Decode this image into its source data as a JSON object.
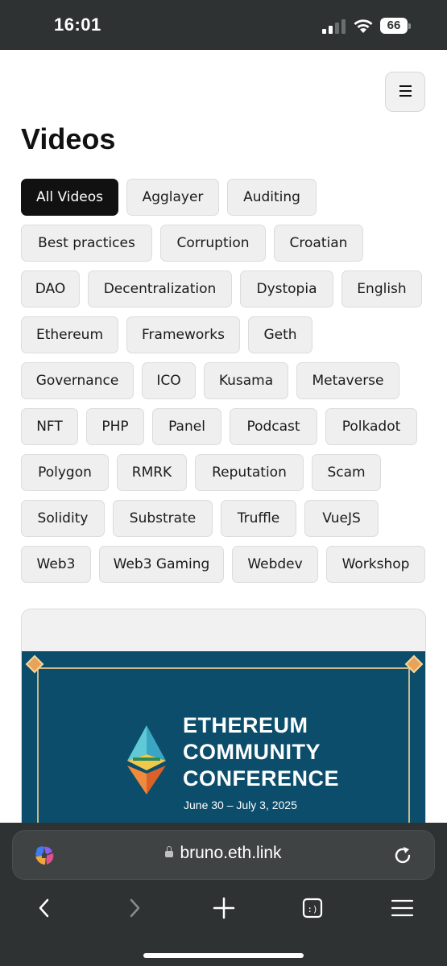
{
  "status_bar": {
    "time": "16:01",
    "battery": "66"
  },
  "page": {
    "title": "Videos"
  },
  "tags": [
    "All Videos",
    "Agglayer",
    "Auditing",
    "Best practices",
    "Corruption",
    "Croatian",
    "DAO",
    "Decentralization",
    "Dystopia",
    "English",
    "Ethereum",
    "Frameworks",
    "Geth",
    "Governance",
    "ICO",
    "Kusama",
    "Metaverse",
    "NFT",
    "PHP",
    "Panel",
    "Podcast",
    "Polkadot",
    "Polygon",
    "RMRK",
    "Reputation",
    "Scam",
    "Solidity",
    "Substrate",
    "Truffle",
    "VueJS",
    "Web3",
    "Web3 Gaming",
    "Webdev",
    "Workshop"
  ],
  "active_tag": "All Videos",
  "video_card": {
    "thumbnail_title_lines": [
      "ETHEREUM",
      "COMMUNITY",
      "CONFERENCE"
    ],
    "thumbnail_dates": "June 30 – July 3, 2025"
  },
  "browser": {
    "url": "bruno.eth.link"
  },
  "icons": {
    "menu": "hamburger-icon",
    "copilot": "copilot-icon",
    "reload": "reload-icon",
    "back": "back-icon",
    "forward": "forward-icon",
    "new_tab": "plus-icon",
    "tabs": "tabs-icon",
    "browser_menu": "hamburger-icon"
  },
  "colors": {
    "status_bar_bg": "#2f3232",
    "active_tag_bg": "#111111",
    "tag_bg": "#efefef",
    "thumbnail_bg": "#0b4d6b",
    "browser_bar_bg": "#2f3232"
  }
}
